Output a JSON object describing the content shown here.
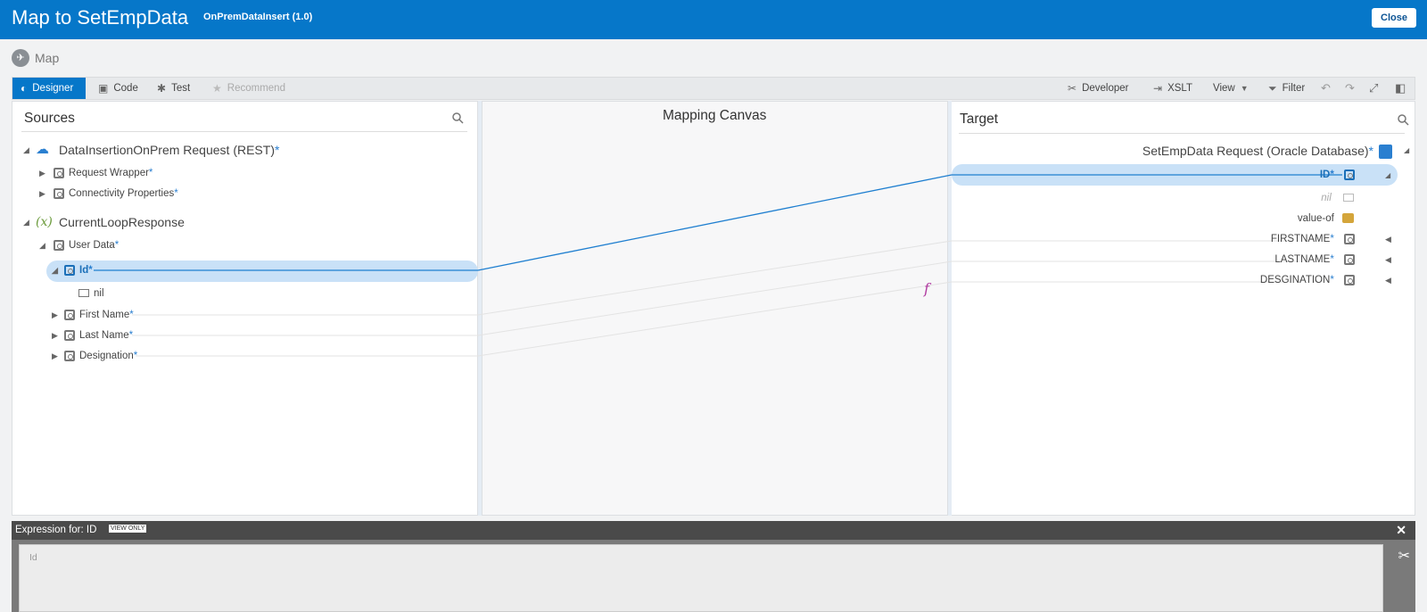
{
  "header": {
    "title": "Map to SetEmpData",
    "subtitle": "OnPremDataInsert (1.0)",
    "close_label": "Close"
  },
  "breadcrumb": {
    "label": "Map"
  },
  "toolbar": {
    "designer": "Designer",
    "code": "Code",
    "test": "Test",
    "recommend": "Recommend",
    "developer": "Developer",
    "xslt": "XSLT",
    "view": "View",
    "filter": "Filter"
  },
  "sources": {
    "title": "Sources",
    "root1": "DataInsertionOnPrem Request (REST)",
    "request_wrapper": "Request Wrapper",
    "connectivity": "Connectivity Properties",
    "root2": "CurrentLoopResponse",
    "user_data": "User Data",
    "id": "Id",
    "nil": "nil",
    "first_name": "First Name",
    "last_name": "Last Name",
    "designation": "Designation"
  },
  "canvas": {
    "title": "Mapping Canvas",
    "function_symbol": "f"
  },
  "target": {
    "title": "Target",
    "root": "SetEmpData Request (Oracle Database)",
    "id": "ID",
    "nil": "nil",
    "value_of": "value-of",
    "firstname": "FIRSTNAME",
    "lastname": "LASTNAME",
    "designation": "DESGINATION"
  },
  "expression": {
    "label": "Expression for: ID",
    "badge": "VIEW ONLY",
    "value": "Id"
  },
  "colors": {
    "brand": "#0677c9",
    "highlight": "#c9e1f7",
    "mapping_line": "#1f7fd0"
  }
}
